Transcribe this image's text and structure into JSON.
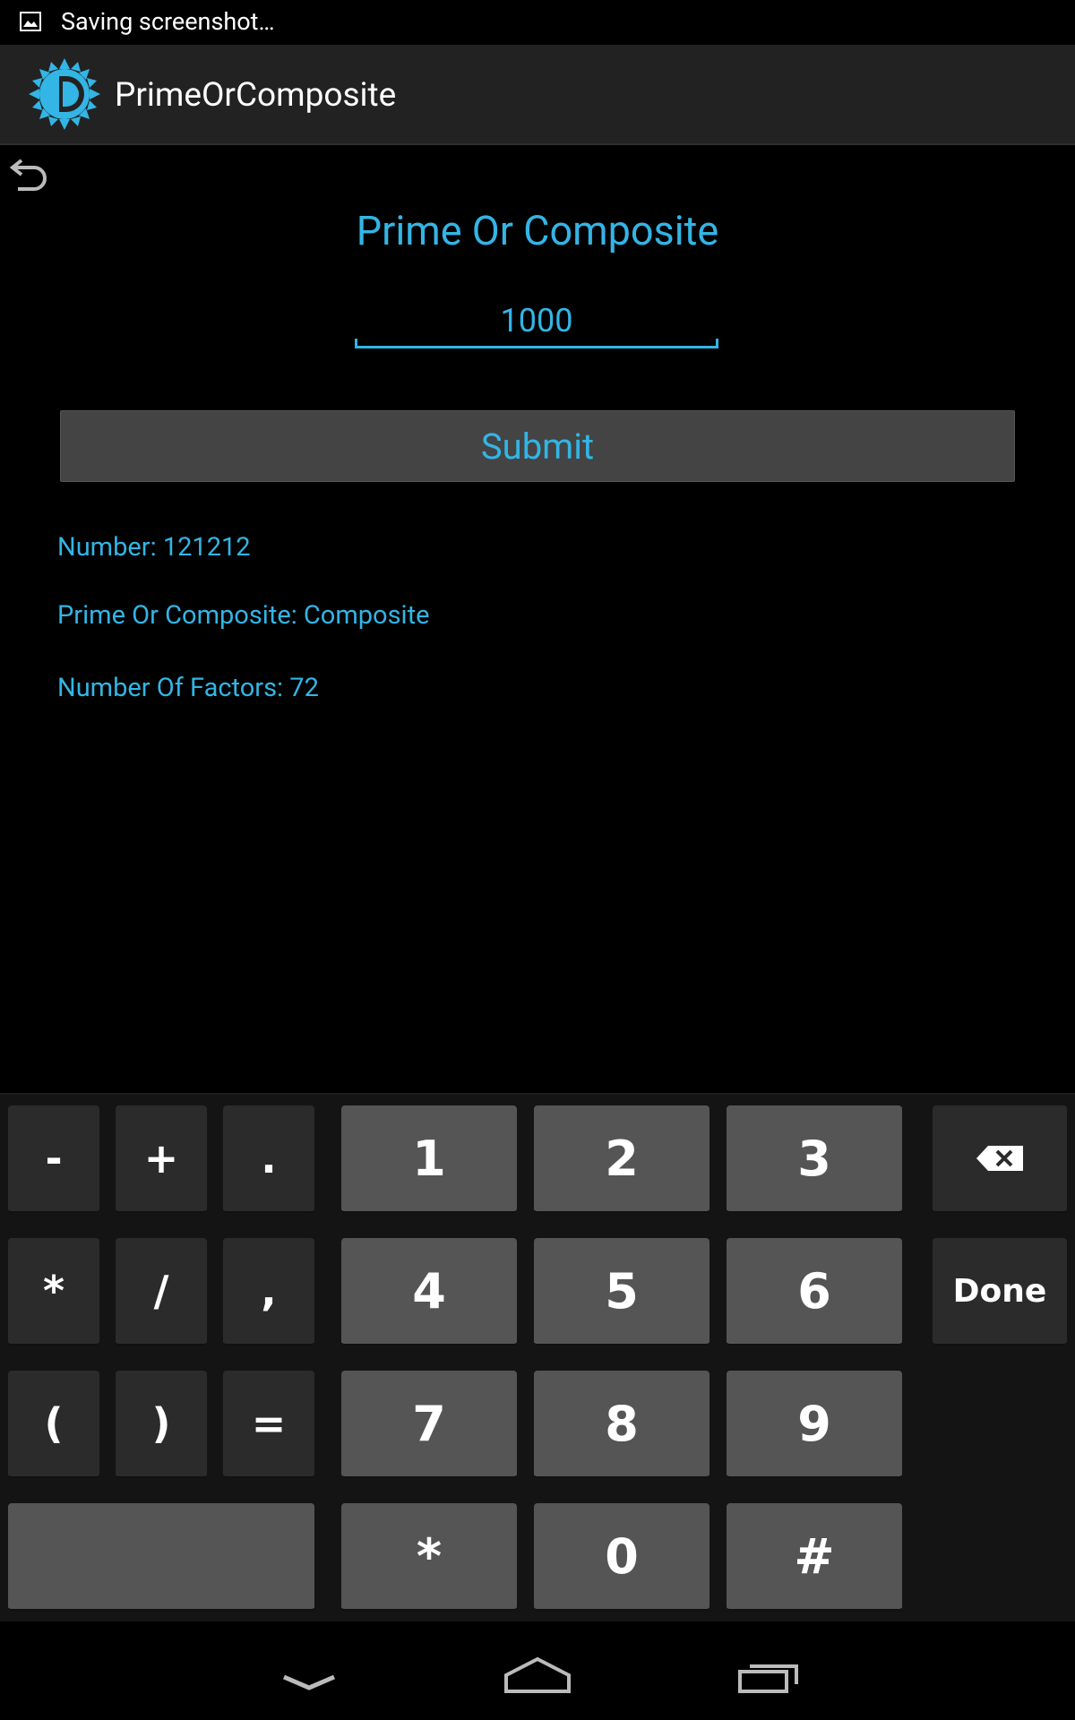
{
  "status_bar": {
    "text": "Saving screenshot…",
    "icon": "image-icon"
  },
  "action_bar": {
    "title": "PrimeOrComposite",
    "logo": "sun-logo-icon"
  },
  "colors": {
    "accent": "#33b5e5",
    "background": "#000000",
    "actionbar": "#222222",
    "keyboard": "#141414"
  },
  "main": {
    "back_icon": "undo-icon",
    "title": "Prime Or Composite",
    "input_value": "1000",
    "submit_label": "Submit",
    "results": {
      "number": "Number: 121212",
      "type": "Prime Or Composite: Composite",
      "factors": "Number Of Factors: 72"
    }
  },
  "keyboard": {
    "row1": [
      "-",
      "+",
      ".",
      "1",
      "2",
      "3"
    ],
    "row2": [
      "*",
      "/",
      ",",
      "4",
      "5",
      "6",
      "Done"
    ],
    "row3": [
      "(",
      ")",
      "=",
      "7",
      "8",
      "9"
    ],
    "row4": [
      "",
      "*",
      "0",
      "#"
    ],
    "backspace_icon": "backspace-icon"
  },
  "nav_bar": [
    "back-nav-icon",
    "home-icon",
    "recent-apps-icon"
  ]
}
